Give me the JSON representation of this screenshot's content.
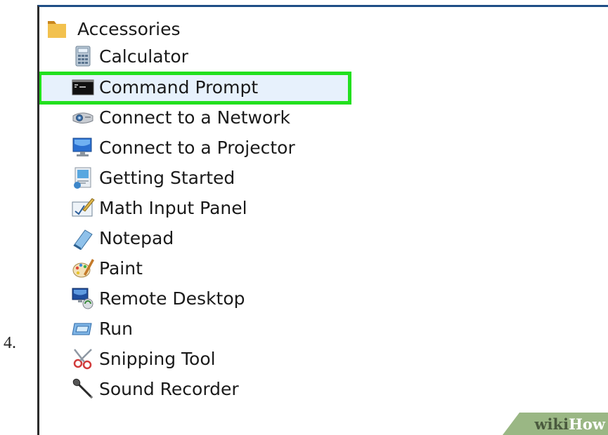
{
  "step": {
    "number": "4."
  },
  "menu": {
    "folder": {
      "label": "Accessories",
      "icon": "folder-icon"
    },
    "items": [
      {
        "label": "Calculator",
        "icon": "calculator-icon"
      },
      {
        "label": "Command Prompt",
        "icon": "command-prompt-icon",
        "highlighted": true
      },
      {
        "label": "Connect to a Network",
        "icon": "network-projector-icon"
      },
      {
        "label": "Connect to a Projector",
        "icon": "monitor-icon"
      },
      {
        "label": "Getting Started",
        "icon": "getting-started-icon"
      },
      {
        "label": "Math Input Panel",
        "icon": "math-input-icon"
      },
      {
        "label": "Notepad",
        "icon": "notepad-icon"
      },
      {
        "label": "Paint",
        "icon": "paint-palette-icon"
      },
      {
        "label": "Remote Desktop",
        "icon": "remote-desktop-icon"
      },
      {
        "label": "Run",
        "icon": "run-icon"
      },
      {
        "label": "Snipping Tool",
        "icon": "scissors-icon"
      },
      {
        "label": "Sound Recorder",
        "icon": "microphone-icon"
      }
    ]
  },
  "colors": {
    "highlight_border": "#22e01e",
    "panel_top_border": "#1f4e86",
    "watermark_bg": "#9ab784"
  },
  "watermark": {
    "part1": "wiki",
    "part2": "How"
  }
}
